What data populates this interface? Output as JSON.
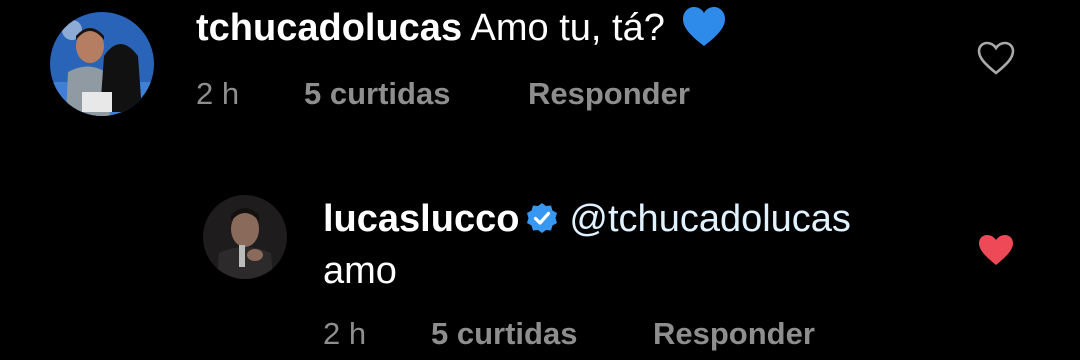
{
  "comments": [
    {
      "username": "tchucadolucas",
      "text": "Amo tu, tá?",
      "emoji": "blue-heart-emoji",
      "time": "2 h",
      "likes": "5 curtidas",
      "reply_label": "Responder",
      "liked": false
    },
    {
      "username": "lucaslucco",
      "verified": true,
      "mention": "@tchucadolucas",
      "text": "amo",
      "time": "2 h",
      "likes": "5 curtidas",
      "reply_label": "Responder",
      "liked": true
    }
  ],
  "colors": {
    "background": "#000000",
    "meta_text": "#8e8e8e",
    "verified_badge": "#3897f0",
    "liked_heart": "#ed4956",
    "blue_heart_emoji": "#2f8bea"
  }
}
